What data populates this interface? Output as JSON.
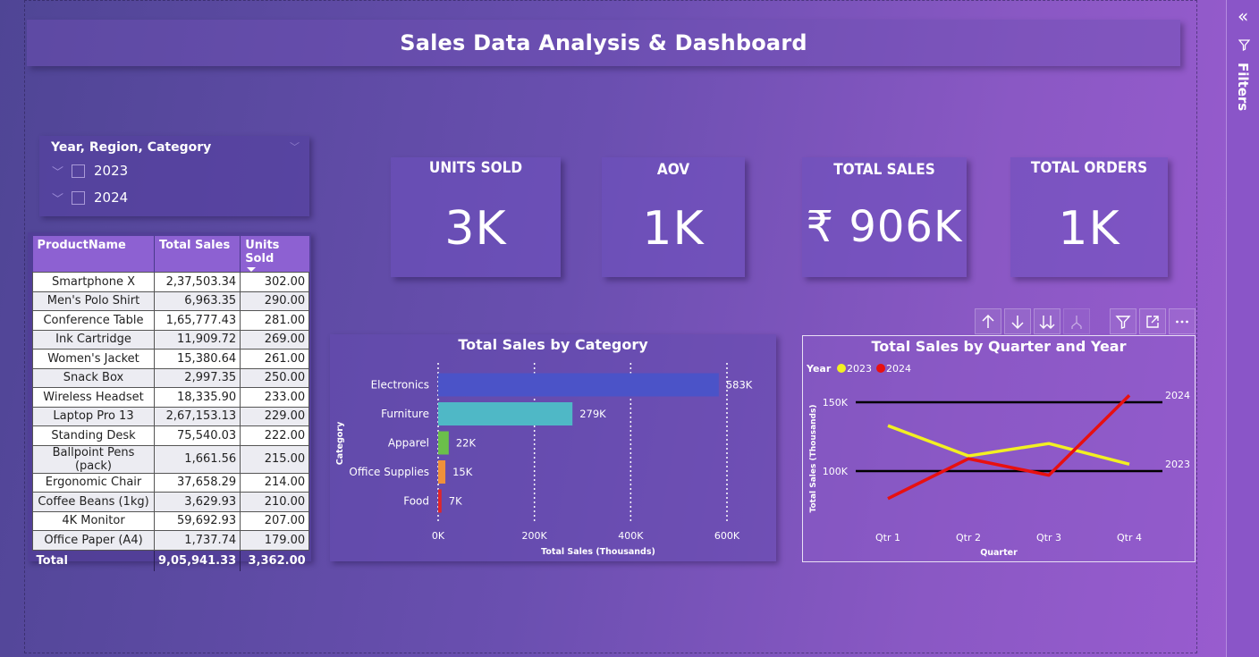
{
  "page": {
    "title": "Sales Data Analysis & Dashboard"
  },
  "filters_pane": {
    "label": "Filters",
    "collapse_icon": "double-chevron-left-icon",
    "filter_icon": "funnel-icon"
  },
  "slicer": {
    "title": "Year, Region, Category",
    "items": [
      {
        "label": "2023",
        "checked": false
      },
      {
        "label": "2024",
        "checked": false
      }
    ]
  },
  "table": {
    "headers": [
      "ProductName",
      "Total Sales",
      "Units Sold"
    ],
    "rows": [
      [
        "Smartphone X",
        "2,37,503.34",
        "302.00"
      ],
      [
        "Men's Polo Shirt",
        "6,963.35",
        "290.00"
      ],
      [
        "Conference Table",
        "1,65,777.43",
        "281.00"
      ],
      [
        "Ink Cartridge",
        "11,909.72",
        "269.00"
      ],
      [
        "Women's Jacket",
        "15,380.64",
        "261.00"
      ],
      [
        "Snack Box",
        "2,997.35",
        "250.00"
      ],
      [
        "Wireless Headset",
        "18,335.90",
        "233.00"
      ],
      [
        "Laptop Pro 13",
        "2,67,153.13",
        "229.00"
      ],
      [
        "Standing Desk",
        "75,540.03",
        "222.00"
      ],
      [
        "Ballpoint Pens (pack)",
        "1,661.56",
        "215.00"
      ],
      [
        "Ergonomic Chair",
        "37,658.29",
        "214.00"
      ],
      [
        "Coffee Beans (1kg)",
        "3,629.93",
        "210.00"
      ],
      [
        "4K Monitor",
        "59,692.93",
        "207.00"
      ],
      [
        "Office Paper (A4)",
        "1,737.74",
        "179.00"
      ]
    ],
    "total": [
      "Total",
      "9,05,941.33",
      "3,362.00"
    ]
  },
  "kpis": [
    {
      "label": "UNITS SOLD",
      "value": "3K"
    },
    {
      "label": "AOV",
      "value": "1K"
    },
    {
      "label": "TOTAL  SALES",
      "value": "₹ 906K"
    },
    {
      "label": "TOTAL ORDERS",
      "value": "1K"
    }
  ],
  "toolbar": {
    "buttons": [
      "arrow-up-icon",
      "arrow-down-icon",
      "double-arrow-down-icon",
      "expand-hierarchy-icon",
      "filter-icon",
      "focus-mode-icon",
      "more-options-icon"
    ]
  },
  "chart_data": [
    {
      "type": "bar",
      "orientation": "horizontal",
      "title": "Total Sales by Category",
      "xlabel": "Total Sales (Thousands)",
      "ylabel": "Category",
      "categories": [
        "Electronics",
        "Furniture",
        "Apparel",
        "Office Supplies",
        "Food"
      ],
      "values": [
        583,
        279,
        22,
        15,
        7
      ],
      "data_labels": [
        "583K",
        "279K",
        "22K",
        "15K",
        "7K"
      ],
      "colors": [
        "#4b53c8",
        "#4fb8c6",
        "#6bbf4a",
        "#f0913a",
        "#e0262a"
      ],
      "xlim": [
        0,
        600
      ],
      "xticks": [
        "0K",
        "200K",
        "400K",
        "600K"
      ],
      "grid": "dotted-vertical"
    },
    {
      "type": "line",
      "title": "Total Sales by Quarter and Year",
      "xlabel": "Quarter",
      "ylabel": "Total Sales (Thousands)",
      "legend_title": "Year",
      "legend_position": "top-left",
      "categories": [
        "Qtr 1",
        "Qtr 2",
        "Qtr 3",
        "Qtr 4"
      ],
      "series": [
        {
          "name": "2023",
          "color": "#f2f022",
          "values": [
            133,
            111,
            120,
            105
          ]
        },
        {
          "name": "2024",
          "color": "#e81010",
          "values": [
            80,
            109,
            97,
            155
          ]
        }
      ],
      "reference_lines": [
        150,
        100
      ],
      "yticks": [
        "150K",
        "100K"
      ],
      "ylim": [
        75,
        160
      ],
      "end_labels": [
        "2024",
        "2023"
      ]
    }
  ]
}
